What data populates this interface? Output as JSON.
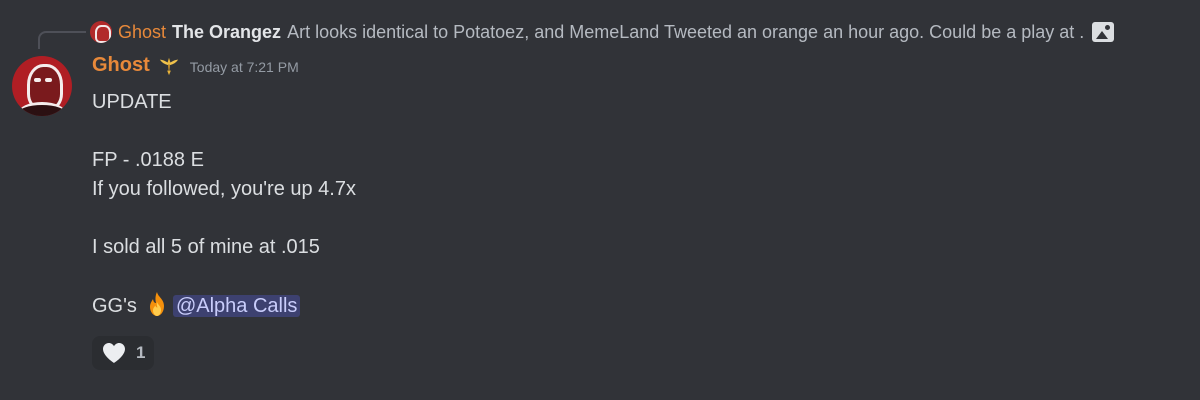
{
  "reply": {
    "author": "Ghost",
    "bold_title": "The Orangez",
    "text": "Art looks identical to Potatoez, and MemeLand Tweeted an orange an hour ago. Could be a play at ."
  },
  "message": {
    "author": "Ghost",
    "timestamp": "Today at 7:21 PM",
    "lines": [
      "UPDATE",
      "",
      "FP - .0188 E",
      "If you followed, you're up 4.7x",
      "",
      "I sold all 5 of mine at .015",
      ""
    ],
    "final_line_prefix": "GG's",
    "mention": "@Alpha Calls"
  },
  "reaction": {
    "emoji": "white-heart-icon",
    "count": "1"
  },
  "colors": {
    "background": "#313338",
    "author": "#e8893a",
    "mention_bg": "#3c4270",
    "mention_text": "#c9cdfb"
  }
}
